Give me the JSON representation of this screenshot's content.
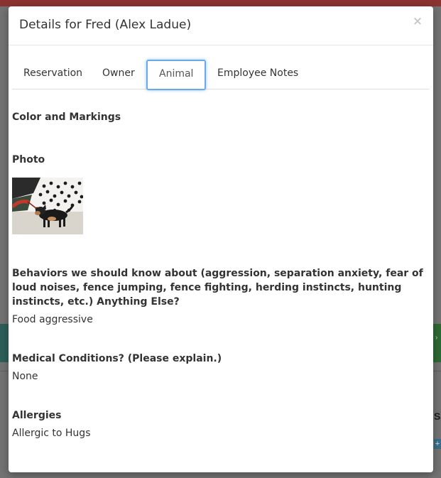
{
  "modal": {
    "title": "Details for Fred (Alex Ladue)",
    "close_symbol": "×"
  },
  "tabs": [
    {
      "label": "Reservation",
      "active": false
    },
    {
      "label": "Owner",
      "active": false
    },
    {
      "label": "Animal",
      "active": true
    },
    {
      "label": "Employee Notes",
      "active": false
    }
  ],
  "animal": {
    "color_markings": {
      "label": "Color and Markings",
      "value": ""
    },
    "photo": {
      "label": "Photo",
      "icon": "dog-photo"
    },
    "behaviors": {
      "label": "Behaviors we should know about (aggression, separation anxiety, fear of loud noises, fence jumping, fence fighting, herding instincts, hunting instincts, etc.) Anything Else?",
      "value": "Food aggressive"
    },
    "medical": {
      "label": "Medical Conditions? (Please explain.)",
      "value": "None"
    },
    "allergies": {
      "label": "Allergies",
      "value": "Allergic to Hugs"
    }
  },
  "background": {
    "partial_text_right": "Se",
    "plus_symbol": "+"
  },
  "colors": {
    "focus_ring": "#6aa9ec",
    "header_bar": "#8c3331",
    "text": "#333333"
  }
}
